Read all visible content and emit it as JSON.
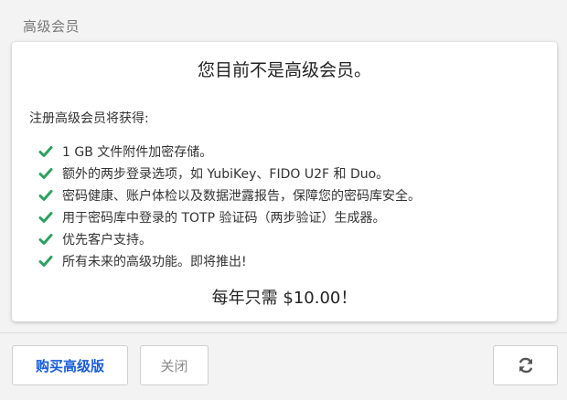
{
  "section": {
    "title": "高级会员"
  },
  "card": {
    "headline": "您目前不是高级会员。",
    "intro": "注册高级会员将获得:",
    "features": [
      {
        "icon": "check-icon",
        "text": "1 GB 文件附件加密存储。"
      },
      {
        "icon": "check-icon",
        "text": "额外的两步登录选项，如 YubiKey、FIDO U2F 和 Duo。"
      },
      {
        "icon": "check-icon",
        "text": "密码健康、账户体检以及数据泄露报告，保障您的密码库安全。"
      },
      {
        "icon": "check-icon",
        "text": "用于密码库中登录的 TOTP 验证码（两步验证）生成器。"
      },
      {
        "icon": "check-icon",
        "text": "优先客户支持。"
      },
      {
        "icon": "check-icon",
        "text": "所有未来的高级功能。即将推出!"
      }
    ],
    "price": "每年只需 $10.00！"
  },
  "footer": {
    "purchase_label": "购买高级版",
    "close_label": "关闭",
    "refresh_icon": "refresh-icon"
  },
  "colors": {
    "accent": "#175ddc",
    "check": "#2ca25f",
    "background": "#f3f3f3",
    "card": "#ffffff"
  }
}
